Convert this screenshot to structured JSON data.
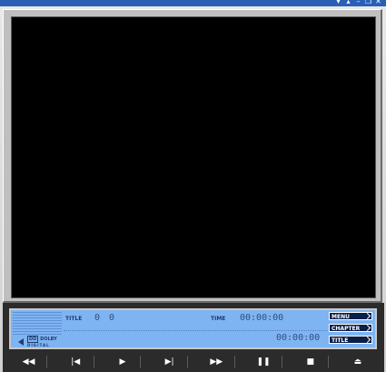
{
  "window": {
    "controls": [
      {
        "name": "dropdown-menu-icon",
        "glyph": "▾"
      },
      {
        "name": "up-arrow-icon",
        "glyph": "▴"
      },
      {
        "name": "minimize-icon",
        "glyph": "–"
      },
      {
        "name": "restore-icon",
        "glyph": "❐"
      },
      {
        "name": "close-icon",
        "glyph": "✕"
      }
    ]
  },
  "panel": {
    "title_label": "TITLE",
    "title_value": "0",
    "chapter_value": "0",
    "time_label": "TIME",
    "time_value": "00:00:00",
    "remaining_value": "00:00:00",
    "dolby_logo_dd": "DD",
    "dolby_logo_text": "DOLBY",
    "dolby_digital": "DIGITAL"
  },
  "side_buttons": {
    "menu": "MENU",
    "chapter": "CHAPTER",
    "title": "TITLE"
  },
  "controls": {
    "rewind": "◀◀",
    "prev": "|◀",
    "play": "▶",
    "next": "▶|",
    "fast_forward": "▶▶",
    "pause": "❚❚",
    "stop": "■",
    "eject": "⏏"
  },
  "colors": {
    "panel": "#7fb4f2",
    "panel_text": "#2e4f80",
    "titlebar": "#2a5fb8",
    "video": "#000000"
  }
}
